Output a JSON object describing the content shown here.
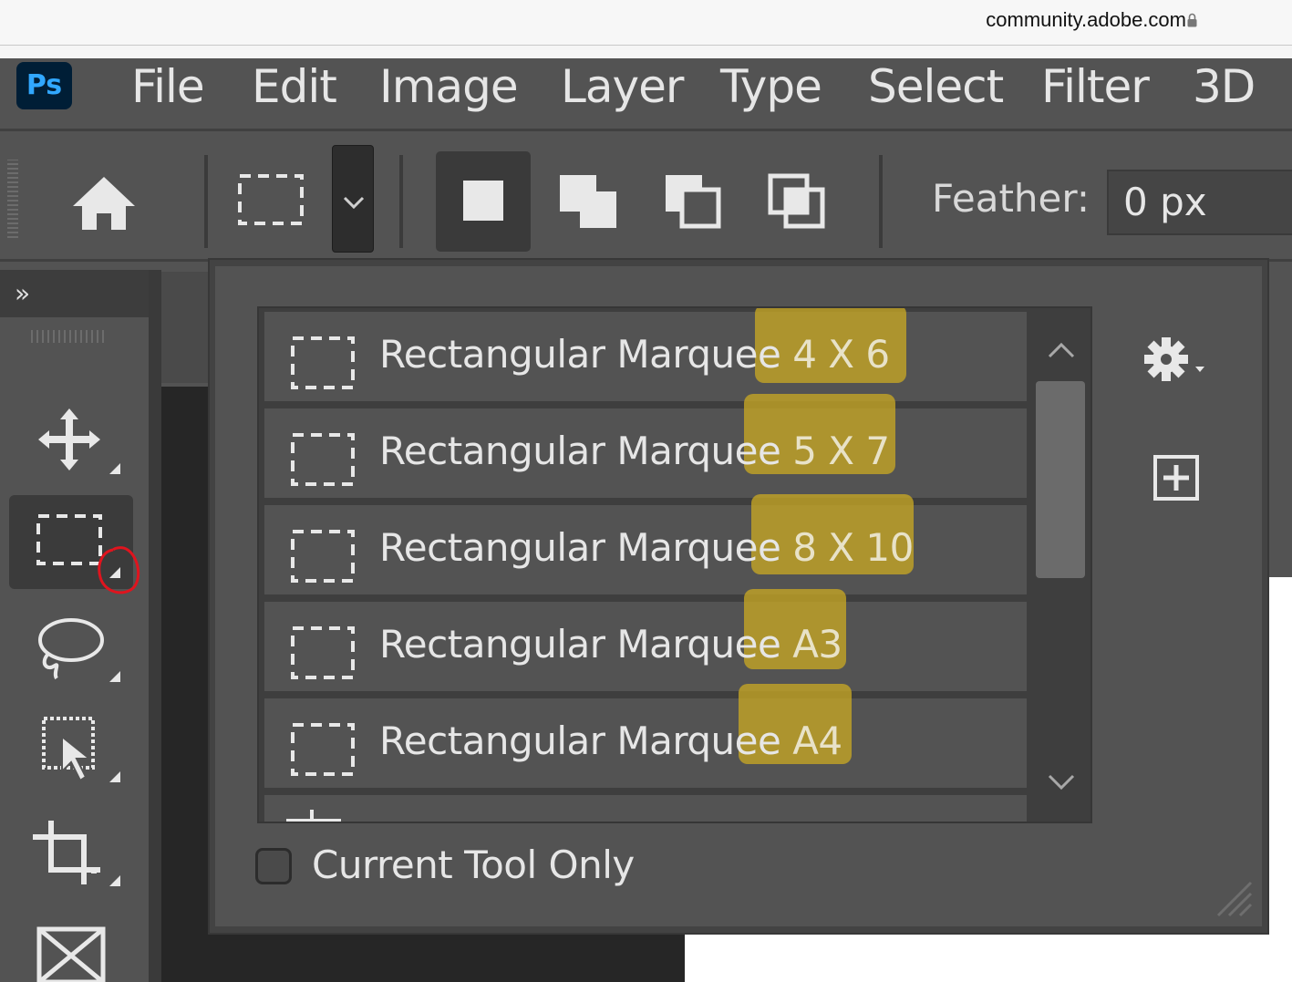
{
  "browser": {
    "url": "community.adobe.com",
    "lock_icon": "lock-icon"
  },
  "app": {
    "logo": "Ps"
  },
  "menu": [
    "File",
    "Edit",
    "Image",
    "Layer",
    "Type",
    "Select",
    "Filter",
    "3D"
  ],
  "options_bar": {
    "feather_label": "Feather:",
    "feather_value": "0 px",
    "icons": [
      "home-icon",
      "marquee-preset-icon",
      "chevron-down-icon",
      "new-selection-icon",
      "add-selection-icon",
      "subtract-selection-icon",
      "intersect-selection-icon"
    ]
  },
  "toolbar": {
    "expand": "»",
    "tools": [
      "move-tool-icon",
      "rectangular-marquee-tool-icon",
      "lasso-tool-icon",
      "object-selection-tool-icon",
      "crop-tool-icon",
      "frame-tool-icon"
    ],
    "active_tool": "rectangular-marquee-tool-icon"
  },
  "preset_picker": {
    "presets": [
      {
        "name": "Rectangular Marquee",
        "suffix": "4 X 6"
      },
      {
        "name": "Rectangular Marquee",
        "suffix": "5 X 7"
      },
      {
        "name": "Rectangular Marquee",
        "suffix": "8 X 10"
      },
      {
        "name": "Rectangular Marquee",
        "suffix": "A3"
      },
      {
        "name": "Rectangular Marquee",
        "suffix": "A4"
      }
    ],
    "current_tool_only_label": "Current Tool Only",
    "current_tool_only_checked": false
  },
  "colors": {
    "ui_bg": "#535353",
    "highlight": "#c6a624",
    "annotation": "#e0141e",
    "ps_blue": "#31a8ff"
  }
}
